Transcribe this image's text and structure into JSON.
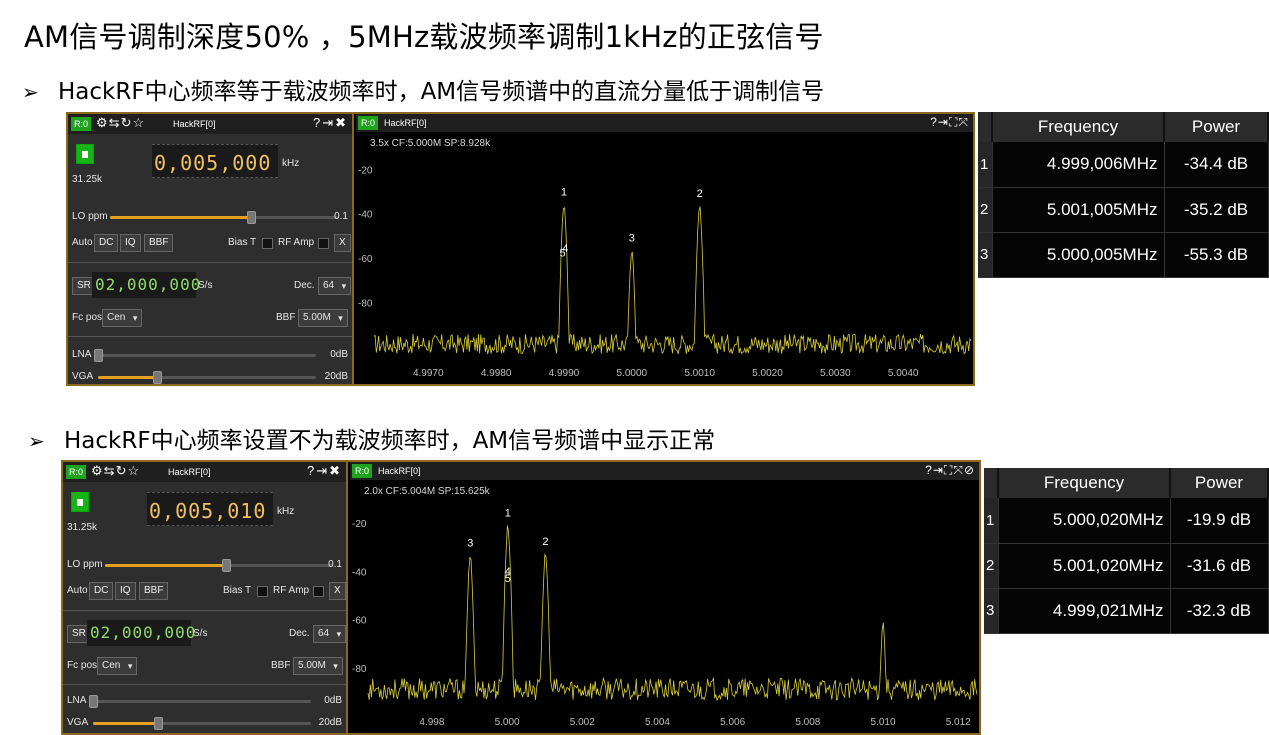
{
  "slide": {
    "title": "AM信号调制深度50%  ，5MHz载波频率调制1kHz的正弦信号",
    "bullet1": "HackRF中心频率等于载波频率时，AM信号频谱中的直流分量低于调制信号",
    "bullet2": "HackRF中心频率设置不为载波频率时，AM信号频谱中显示正常",
    "arrow": "➢"
  },
  "panel1": {
    "ctrl": {
      "badge": "R:0",
      "name": "HackRF[0]",
      "sample_rate_small": "31.25k",
      "frequency": "0,005,000",
      "freq_unit": "kHz",
      "lo_label": "LO ppm",
      "lo_value": "0.1",
      "lo_level": 0.62,
      "auto_label": "Auto",
      "dc_label": "DC",
      "iq_label": "IQ",
      "bbf_btn_label": "BBF",
      "biast_label": "Bias T",
      "rfamp_label": "RF Amp",
      "x_label": "X",
      "sr_label": "SR",
      "sr_value": "02,000,000",
      "sr_unit": "S/s",
      "dec_label": "Dec.",
      "dec_value": "64",
      "fcpos_label": "Fc pos",
      "fcpos_value": "Cen",
      "bbf_label": "BBF",
      "bbf_value": "5.00M",
      "lna_label": "LNA",
      "lna_value": "0dB",
      "lna_level": 0.0,
      "vga_label": "VGA",
      "vga_value": "20dB",
      "vga_level": 0.27
    },
    "spectrum": {
      "badge": "R:0",
      "name": "HackRF[0]",
      "info": "3.5x CF:5.000M SP:8.928k"
    }
  },
  "panel2": {
    "ctrl": {
      "badge": "R:0",
      "name": "HackRF[0]",
      "sample_rate_small": "31.25k",
      "frequency": "0,005,010",
      "freq_unit": "kHz",
      "lo_label": "LO ppm",
      "lo_value": "0.1",
      "lo_level": 0.53,
      "auto_label": "Auto",
      "dc_label": "DC",
      "iq_label": "IQ",
      "bbf_btn_label": "BBF",
      "biast_label": "Bias T",
      "rfamp_label": "RF Amp",
      "x_label": "X",
      "sr_label": "SR",
      "sr_value": "02,000,000",
      "sr_unit": "S/s",
      "dec_label": "Dec.",
      "dec_value": "64",
      "fcpos_label": "Fc pos",
      "fcpos_value": "Cen",
      "bbf_label": "BBF",
      "bbf_value": "5.00M",
      "lna_label": "LNA",
      "lna_value": "0dB",
      "lna_level": 0.0,
      "vga_label": "VGA",
      "vga_value": "20dB",
      "vga_level": 0.3
    },
    "spectrum": {
      "badge": "R:0",
      "name": "HackRF[0]",
      "info": "2.0x CF:5.004M SP:15.625k"
    }
  },
  "table1": {
    "headers": [
      "Frequency",
      "Power"
    ],
    "rows": [
      {
        "idx": "1",
        "freq": "4.999,006MHz",
        "power": "-34.4 dB"
      },
      {
        "idx": "2",
        "freq": "5.001,005MHz",
        "power": "-35.2 dB"
      },
      {
        "idx": "3",
        "freq": "5.000,005MHz",
        "power": "-55.3 dB"
      }
    ]
  },
  "table2": {
    "headers": [
      "Frequency",
      "Power"
    ],
    "rows": [
      {
        "idx": "1",
        "freq": "5.000,020MHz",
        "power": "-19.9 dB"
      },
      {
        "idx": "2",
        "freq": "5.001,020MHz",
        "power": "-31.6 dB"
      },
      {
        "idx": "3",
        "freq": "4.999,021MHz",
        "power": "-32.3 dB"
      }
    ]
  },
  "chart_data": [
    {
      "type": "line",
      "title": "3.5x CF:5.000M SP:8.928k",
      "xlabel": "",
      "ylabel": "",
      "xlim": [
        4.9962,
        5.005
      ],
      "ylim": [
        -105,
        -5
      ],
      "x_ticks": [
        "4.9970",
        "4.9980",
        "4.9990",
        "5.0000",
        "5.0010",
        "5.0020",
        "5.0030",
        "5.0040"
      ],
      "x_tick_values": [
        4.997,
        4.998,
        4.999,
        5.0,
        5.001,
        5.002,
        5.003,
        5.004
      ],
      "y_ticks": [
        "-20",
        "-40",
        "-60",
        "-80"
      ],
      "y_tick_values": [
        -20,
        -40,
        -60,
        -80
      ],
      "noise_floor": -100,
      "peaks": [
        {
          "x": 4.999,
          "y": -34.4
        },
        {
          "x": 5.001,
          "y": -35.2
        },
        {
          "x": 5.0,
          "y": -55.3
        }
      ],
      "markers": [
        {
          "label": "1",
          "x": 4.999,
          "y": -34.4
        },
        {
          "label": "2",
          "x": 5.001,
          "y": -35.2
        },
        {
          "label": "3",
          "x": 5.0,
          "y": -55.3
        },
        {
          "label": "4",
          "x": 4.99902,
          "y": -60
        },
        {
          "label": "5",
          "x": 4.99898,
          "y": -62
        }
      ],
      "grid": false,
      "color": "#d8cf3a"
    },
    {
      "type": "line",
      "title": "2.0x CF:5.004M SP:15.625k",
      "xlabel": "",
      "ylabel": "",
      "xlim": [
        4.9963,
        5.0125
      ],
      "ylim": [
        -96,
        -4
      ],
      "x_ticks": [
        "4.998",
        "5.000",
        "5.002",
        "5.004",
        "5.006",
        "5.008",
        "5.010",
        "5.012"
      ],
      "x_tick_values": [
        4.998,
        5.0,
        5.002,
        5.004,
        5.006,
        5.008,
        5.01,
        5.012
      ],
      "y_ticks": [
        "-20",
        "-40",
        "-60",
        "-80"
      ],
      "y_tick_values": [
        -20,
        -40,
        -60,
        -80
      ],
      "noise_floor": -90,
      "peaks": [
        {
          "x": 5.00002,
          "y": -19.9
        },
        {
          "x": 5.00102,
          "y": -31.6
        },
        {
          "x": 4.99902,
          "y": -32.3
        },
        {
          "x": 5.01,
          "y": -60
        }
      ],
      "markers": [
        {
          "label": "1",
          "x": 5.00002,
          "y": -19.9
        },
        {
          "label": "2",
          "x": 5.00102,
          "y": -31.6
        },
        {
          "label": "3",
          "x": 4.99902,
          "y": -32.3
        },
        {
          "label": "4",
          "x": 5.00002,
          "y": -44
        },
        {
          "label": "5",
          "x": 5.00002,
          "y": -47
        }
      ],
      "grid": false,
      "color": "#d8cf3a"
    }
  ]
}
